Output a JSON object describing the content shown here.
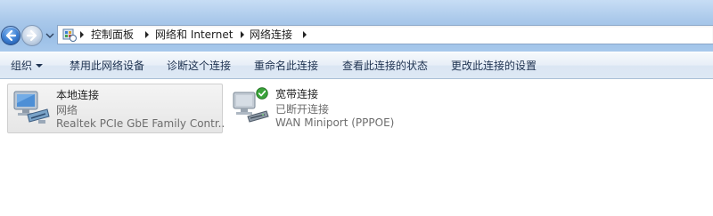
{
  "address_bar": {
    "breadcrumbs": [
      "控制面板",
      "网络和 Internet",
      "网络连接"
    ]
  },
  "command_bar": {
    "items": [
      {
        "label": "组织",
        "has_dropdown": true
      },
      {
        "label": "禁用此网络设备"
      },
      {
        "label": "诊断这个连接"
      },
      {
        "label": "重命名此连接"
      },
      {
        "label": "查看此连接的状态"
      },
      {
        "label": "更改此连接的设置"
      }
    ]
  },
  "connections": [
    {
      "name": "本地连接",
      "status": "网络",
      "device": "Realtek PCIe GbE Family Contr...",
      "selected": true,
      "icon": "network-adapter-icon"
    },
    {
      "name": "宽带连接",
      "status": "已断开连接",
      "device": "WAN Miniport (PPPOE)",
      "selected": false,
      "icon": "broadband-modem-icon"
    }
  ],
  "colors": {
    "address_gradient_top": "#c7ddf5",
    "address_gradient_bottom": "#9bbfe6",
    "command_text": "#1e3250",
    "status_text": "#6d6d6d",
    "check_green": "#3aa33a"
  }
}
